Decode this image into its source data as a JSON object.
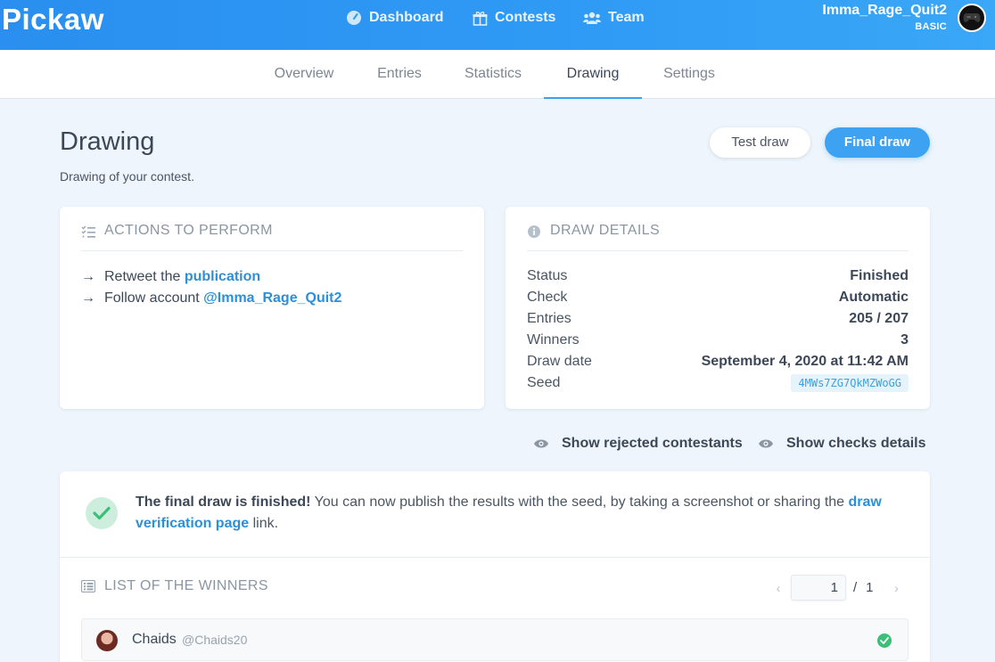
{
  "app": {
    "logo": "Pickaw"
  },
  "topnav": {
    "dashboard": "Dashboard",
    "contests": "Contests",
    "team": "Team"
  },
  "user": {
    "name": "Imma_Rage_Quit2",
    "plan": "BASIC"
  },
  "tabs": [
    {
      "label": "Overview"
    },
    {
      "label": "Entries"
    },
    {
      "label": "Statistics"
    },
    {
      "label": "Drawing",
      "active": true
    },
    {
      "label": "Settings"
    }
  ],
  "page": {
    "title": "Drawing",
    "subtitle": "Drawing of your contest.",
    "test_draw_label": "Test draw",
    "final_draw_label": "Final draw"
  },
  "actions_card": {
    "title": "ACTIONS TO PERFORM",
    "items": [
      {
        "prefix": "Retweet the ",
        "link": "publication"
      },
      {
        "prefix": "Follow account ",
        "link": "@Imma_Rage_Quit2"
      }
    ]
  },
  "details_card": {
    "title": "DRAW DETAILS",
    "rows": [
      {
        "label": "Status",
        "value": "Finished"
      },
      {
        "label": "Check",
        "value": "Automatic"
      },
      {
        "label": "Entries",
        "value": "205 / 207"
      },
      {
        "label": "Winners",
        "value": "3"
      },
      {
        "label": "Draw date",
        "value": "September 4, 2020 at 11:42 AM"
      },
      {
        "label": "Seed",
        "value": "4MWs7ZG7QkMZWoGG"
      }
    ]
  },
  "toggles": {
    "rejected": "Show rejected contestants",
    "checks": "Show checks details"
  },
  "result": {
    "bold": "The final draw is finished!",
    "text": " You can now publish the results with the seed, by taking a screenshot or sharing the ",
    "link": "draw verification page",
    "suffix": " link."
  },
  "winners": {
    "title": "LIST OF THE WINNERS",
    "page": "1",
    "page_sep": "/",
    "page_total": "1",
    "list": [
      {
        "name": "Chaids",
        "handle": "@Chaids20"
      }
    ]
  },
  "colors": {
    "topbar": "#2f9bf5",
    "accent": "#3da2f2",
    "link": "#2b90d9",
    "success": "#3cbf76",
    "background": "#eef5fc"
  }
}
